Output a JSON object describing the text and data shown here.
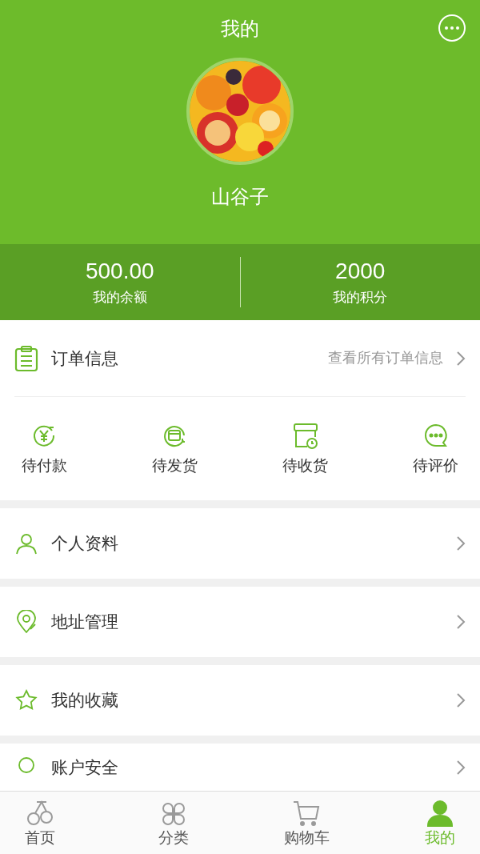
{
  "header": {
    "title": "我的",
    "username": "山谷子"
  },
  "stats": [
    {
      "value": "500.00",
      "label": "我的余额"
    },
    {
      "value": "2000",
      "label": "我的积分"
    }
  ],
  "orders": {
    "title": "订单信息",
    "link": "查看所有订单信息",
    "items": [
      {
        "kind": "pay",
        "label": "待付款"
      },
      {
        "kind": "ship",
        "label": "待发货"
      },
      {
        "kind": "receive",
        "label": "待收货"
      },
      {
        "kind": "review",
        "label": "待评价"
      }
    ]
  },
  "menu": [
    {
      "kind": "profile",
      "label": "个人资料"
    },
    {
      "kind": "address",
      "label": "地址管理"
    },
    {
      "kind": "favorite",
      "label": "我的收藏"
    },
    {
      "kind": "security",
      "label": "账户安全"
    }
  ],
  "tab_bar": [
    {
      "kind": "home",
      "label": "首页",
      "selected": false
    },
    {
      "kind": "category",
      "label": "分类",
      "selected": false
    },
    {
      "kind": "cart",
      "label": "购物车",
      "selected": false
    },
    {
      "kind": "me",
      "label": "我的",
      "selected": true
    }
  ]
}
